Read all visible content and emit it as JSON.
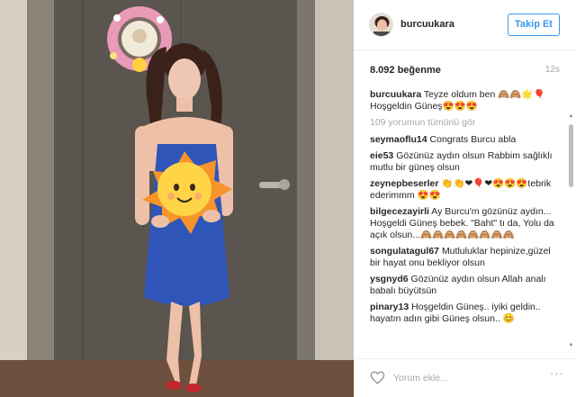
{
  "post": {
    "username": "burcuukara",
    "follow_label": "Takip Et",
    "likes": "8.092 beğenme",
    "time": "12s"
  },
  "comments": [
    {
      "user": "burcuukara",
      "text": "Teyze oldum ben 🙈🙈🌟🎈 Hoşgeldin Güneş😍😍😍"
    },
    {
      "view_all": "109 yorumun tümünü gör"
    },
    {
      "user": "seymaoflu14",
      "text": "Congrats Burcu abla"
    },
    {
      "user": "eie53",
      "text": "Gözünüz aydın olsun Rabbim sağlıklı mutlu bir güneş olsun"
    },
    {
      "user": "zeynepbeserler",
      "text": "👏👏❤🎈❤😍😍😍tebrik ederimmm 😍😍"
    },
    {
      "user": "bilgecezayirli",
      "text": "Ay Burcu'm gözünüz aydın... Hoşgeldi Güneş bebek. \"Baht\" tı da, Yolu da açık olsun...🙈🙈🙈🙈🙈🙈🙈🙈"
    },
    {
      "user": "songulatagul67",
      "text": "Mutluluklar hepinize,güzel bir hayat onu bekliyor olsun"
    },
    {
      "user": "ysgnyd6",
      "text": "Gözünüz aydın olsun Allah analı babalı büyütsün"
    },
    {
      "user": "pinary13",
      "text": "Hoşgeldin Güneş.. iyiki geldin.. hayatın adın gibi Güneş olsun.. 😊"
    }
  ],
  "footer": {
    "comment_placeholder": "Yorum ekle...",
    "more_icon": "ellipsis-icon",
    "like_icon": "heart-outline-icon"
  },
  "colors": {
    "accent": "#3897f0",
    "muted": "#a5a7aa"
  }
}
